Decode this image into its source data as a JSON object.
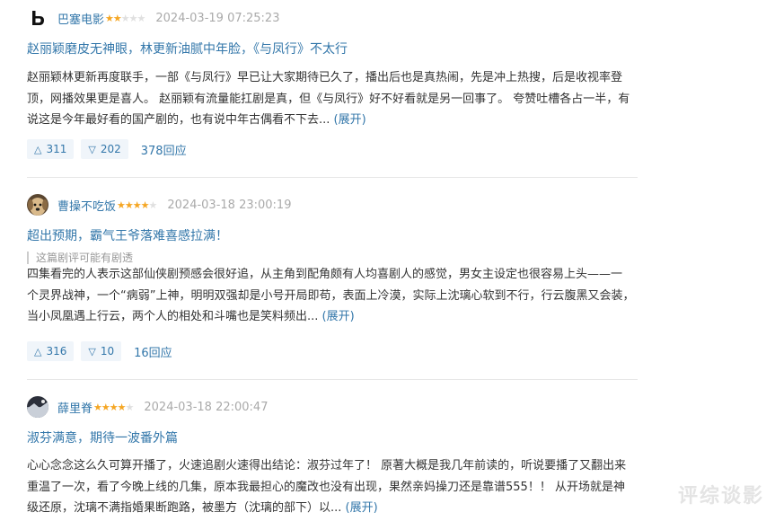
{
  "reviews": [
    {
      "username": "巴塞电影",
      "rating": 2,
      "time": "2024-03-19 07:25:23",
      "title": "赵丽颖磨皮无神眼，林更新油腻中年脸，《与凤行》不太行",
      "spoiler": "",
      "body_lines": [
        "赵丽颖林更新再度联手，一部《与凤行》早已让大家期待已久了，播出后也是真热闹，先是冲上热搜，后是收视率登",
        "顶，网播效果更是喜人。 赵丽颖有流量能扛剧是真，但《与凤行》好不好看就是另一回事了。 夸赞吐槽各占一半，有",
        "说这是今年最好看的国产剧的，也有说中年古偶看不下去..."
      ],
      "expand": "(展开)",
      "up": "311",
      "down": "202",
      "replies": "378回应"
    },
    {
      "username": "曹操不吃饭",
      "rating": 4,
      "time": "2024-03-18 23:00:19",
      "title": "超出预期，霸气王爷落难喜感拉满！",
      "spoiler": "这篇剧评可能有剧透",
      "body_lines": [
        "四集看完的人表示这部仙侠剧预感会很好追，从主角到配角颇有人均喜剧人的感觉，男女主设定也很容易上头——一",
        "个灵界战神，一个“病弱”上神，明明双强却是小号开局即苟，表面上冷漠，实际上沈璃心软到不行，行云腹黑又会装，",
        "当小凤凰遇上行云，两个人的相处和斗嘴也是笑料频出..."
      ],
      "expand": "(展开)",
      "up": "316",
      "down": "10",
      "replies": "16回应"
    },
    {
      "username": "薛里脊",
      "rating": 4,
      "time": "2024-03-18 22:00:47",
      "title": "淑芬满意，期待一波番外篇",
      "spoiler": "",
      "body_lines": [
        "心心念念这么久可算开播了，火速追剧火速得出结论：淑芬过年了！ 原著大概是我几年前读的，听说要播了又翻出来",
        "重温了一次，看了今晚上线的几集，原本我最担心的魔改也没有出现，果然亲妈操刀还是靠谱555！！ 从开场就是神",
        "级还原，沈璃不满指婚果断跑路，被墨方（沈璃的部下）以..."
      ],
      "expand": "(展开)",
      "up": "",
      "down": "",
      "replies": ""
    }
  ],
  "icons": {
    "star": "★",
    "upvote": "△",
    "downvote": "▽"
  },
  "watermark": "评综谈影",
  "colors": {
    "link": "#3377aa",
    "star_on": "#f5a623",
    "star_off": "#e0e0e0",
    "vote_bg": "#f0f5fa"
  }
}
